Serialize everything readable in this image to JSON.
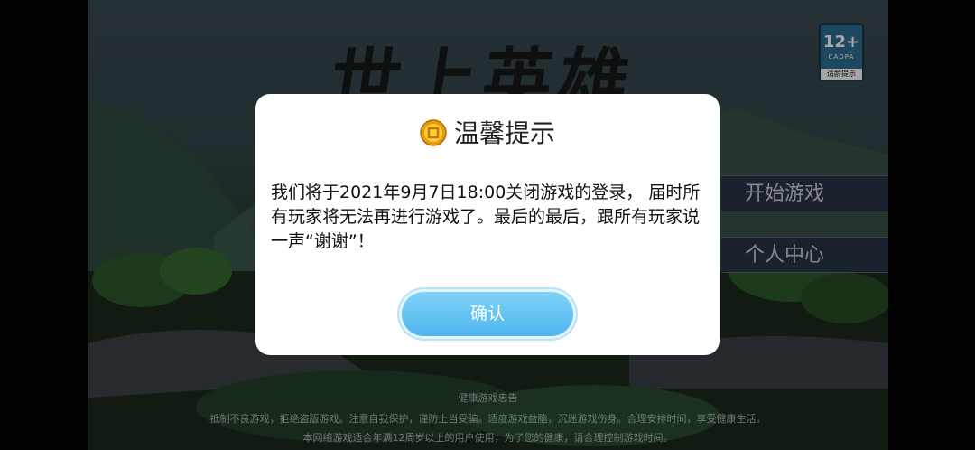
{
  "game": {
    "logo_text": "世上英雄",
    "age_rating": {
      "number": "12+",
      "org": "CADPA",
      "label": "适龄提示"
    },
    "menu": {
      "start": "开始游戏",
      "profile": "个人中心"
    },
    "health_notice": {
      "title": "健康游戏忠告",
      "line1": "抵制不良游戏，拒绝盗版游戏。注意自我保护，谨防上当受骗。适度游戏益脑，沉迷游戏伤身。合理安排时间，享受健康生活。",
      "line2": "本网络游戏适合年满12周岁以上的用户使用，为了您的健康，请合理控制游戏时间。"
    }
  },
  "dialog": {
    "icon": "coin-icon",
    "title": "温馨提示",
    "message": "我们将于2021年9月7日18:00关闭游戏的登录， 届时所有玩家将无法再进行游戏了。最后的最后，跟所有玩家说一声“谢谢”！",
    "confirm_label": "确认"
  },
  "colors": {
    "confirm_button": "#5bbdf0",
    "dialog_bg": "#ffffff",
    "age_badge": "#2e6f92"
  }
}
